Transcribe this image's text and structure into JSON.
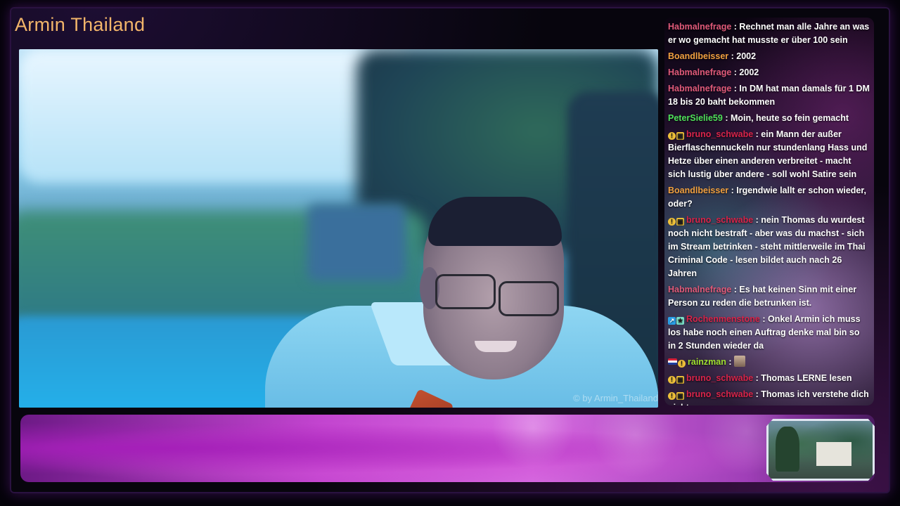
{
  "stream": {
    "title": "Armin Thailand",
    "watermark": "© by Armin_Thailand"
  },
  "chat": {
    "messages": [
      {
        "user": "Habmalnefrage",
        "color": "#e05a7a",
        "badges": [],
        "text": "Rechnet man alle Jahre an was er wo gemacht hat musste er über 100 sein"
      },
      {
        "user": "Boandlbeisser",
        "color": "#f0a040",
        "badges": [],
        "text": "2002"
      },
      {
        "user": "Habmalnefrage",
        "color": "#e05a7a",
        "badges": [],
        "text": "2002"
      },
      {
        "user": "Habmalnefrage",
        "color": "#e05a7a",
        "badges": [],
        "text": "In DM hat man damals für 1 DM 18 bis 20 baht bekommen"
      },
      {
        "user": "PeterSielie59",
        "color": "#4fe05a",
        "badges": [],
        "text": "Moin, heute so fein gemacht"
      },
      {
        "user": "bruno_schwabe",
        "color": "#d8244a",
        "badges": [
          "info-badge",
          "camera-badge"
        ],
        "text": "ein Mann der außer Bierflaschennuckeln nur stundenlang Hass und Hetze über einen anderen verbreitet - macht sich lustig über andere - soll wohl Satire sein"
      },
      {
        "user": "Boandlbeisser",
        "color": "#f0a040",
        "badges": [],
        "text": "Irgendwie lallt er schon wieder, oder?"
      },
      {
        "user": "bruno_schwabe",
        "color": "#d8244a",
        "badges": [
          "info-badge",
          "camera-badge"
        ],
        "text": "nein Thomas du wurdest noch nicht bestraft - aber was du machst - sich im Stream betrinken - steht mittlerweile im Thai Criminal Code - lesen bildet auch nach 26 Jahren"
      },
      {
        "user": "Habmalnefrage",
        "color": "#e05a7a",
        "badges": [],
        "text": "Es hat keinen Sinn mit einer Person zu reden die betrunken ist."
      },
      {
        "user": "Rochenmenstone",
        "color": "#d8244a",
        "badges": [
          "pin-badge",
          "sub-badge"
        ],
        "text": "Onkel Armin ich muss los habe noch einen Auftrag denke mal bin so in 2 Stunden wieder da"
      },
      {
        "user": "rainzman",
        "color": "#a0e030",
        "badges": [
          "flag-badge",
          "info-badge"
        ],
        "text": "",
        "emote": "face-emote"
      },
      {
        "user": "bruno_schwabe",
        "color": "#d8244a",
        "badges": [
          "info-badge",
          "camera-badge"
        ],
        "text": "Thomas LERNE lesen"
      },
      {
        "user": "bruno_schwabe",
        "color": "#d8244a",
        "badges": [
          "info-badge",
          "camera-badge"
        ],
        "text": "Thomas ich verstehe dich nicht"
      }
    ]
  },
  "colors": {
    "title": "#f2b56a",
    "accent_purple": "#c244cf"
  }
}
